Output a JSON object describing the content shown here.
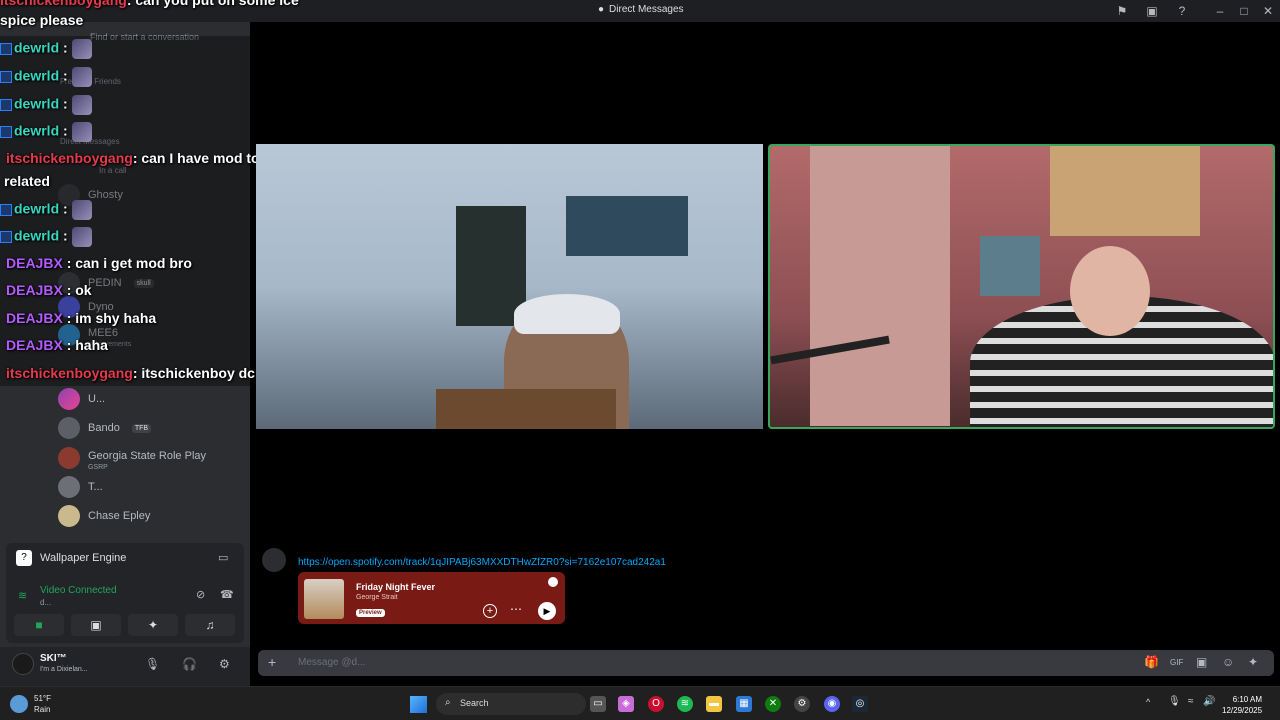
{
  "window": {
    "title": "Direct Messages"
  },
  "sidebar": {
    "search_placeholder": "Find or start a conversation",
    "friends_label": "Frequent Friends",
    "dm_header": "Direct Messages",
    "in_call": "In a call",
    "dms": [
      {
        "name": "Ghosty",
        "sub": ""
      },
      {
        "name": "PEDIN",
        "tag": "skull"
      },
      {
        "name": "Dyno"
      },
      {
        "name": "MEE6",
        "sub": "achievements"
      },
      {
        "name": "U..."
      },
      {
        "name": "Bando",
        "tag": "TFB"
      },
      {
        "name": "Georgia State Role Play",
        "sub": "GSRP"
      },
      {
        "name": "T..."
      },
      {
        "name": "Chase Epley"
      }
    ]
  },
  "voice": {
    "app_name": "Wallpaper Engine",
    "status": "Video Connected",
    "status_sub": "d..."
  },
  "user": {
    "name": "SKI™",
    "status": "I'm a Dixielan..."
  },
  "chat_overlay": {
    "messages": [
      {
        "user": "itschickenboygang",
        "text": ": can you put on some ice"
      },
      {
        "user": "",
        "text": "spice please"
      },
      {
        "user": "dewrld",
        "text": ":"
      },
      {
        "user": "dewrld",
        "text": ":"
      },
      {
        "user": "dewrld",
        "text": ":"
      },
      {
        "user": "dewrld",
        "text": ":"
      },
      {
        "user": "itschickenboygang",
        "text": ": can I have mod too we're"
      },
      {
        "user": "",
        "text": "related"
      },
      {
        "user": "dewrld",
        "text": ":"
      },
      {
        "user": "dewrld",
        "text": ":"
      },
      {
        "user": "DEAJBX",
        "text": ": can i get mod bro"
      },
      {
        "user": "DEAJBX",
        "text": ": ok"
      },
      {
        "user": "DEAJBX",
        "text": ": im shy haha"
      },
      {
        "user": "DEAJBX",
        "text": ": haha"
      },
      {
        "user": "itschickenboygang",
        "text": ": itschickenboy dc"
      }
    ]
  },
  "message": {
    "link": "https://open.spotify.com/track/1qJIPABj63MXXDTHwZfZR0?si=7162e107cad242a1",
    "song": "Friday Night Fever",
    "artist": "George Strait",
    "preview": "Preview"
  },
  "composer": {
    "placeholder": "Message @d..."
  },
  "taskbar": {
    "temp": "51°F",
    "weather": "Rain",
    "search": "Search",
    "time": "6:10 AM",
    "date": "12/29/2025"
  },
  "colors": {
    "accent": "#23a55a",
    "spotify": "#7a1a14",
    "link": "#00a8fc"
  }
}
